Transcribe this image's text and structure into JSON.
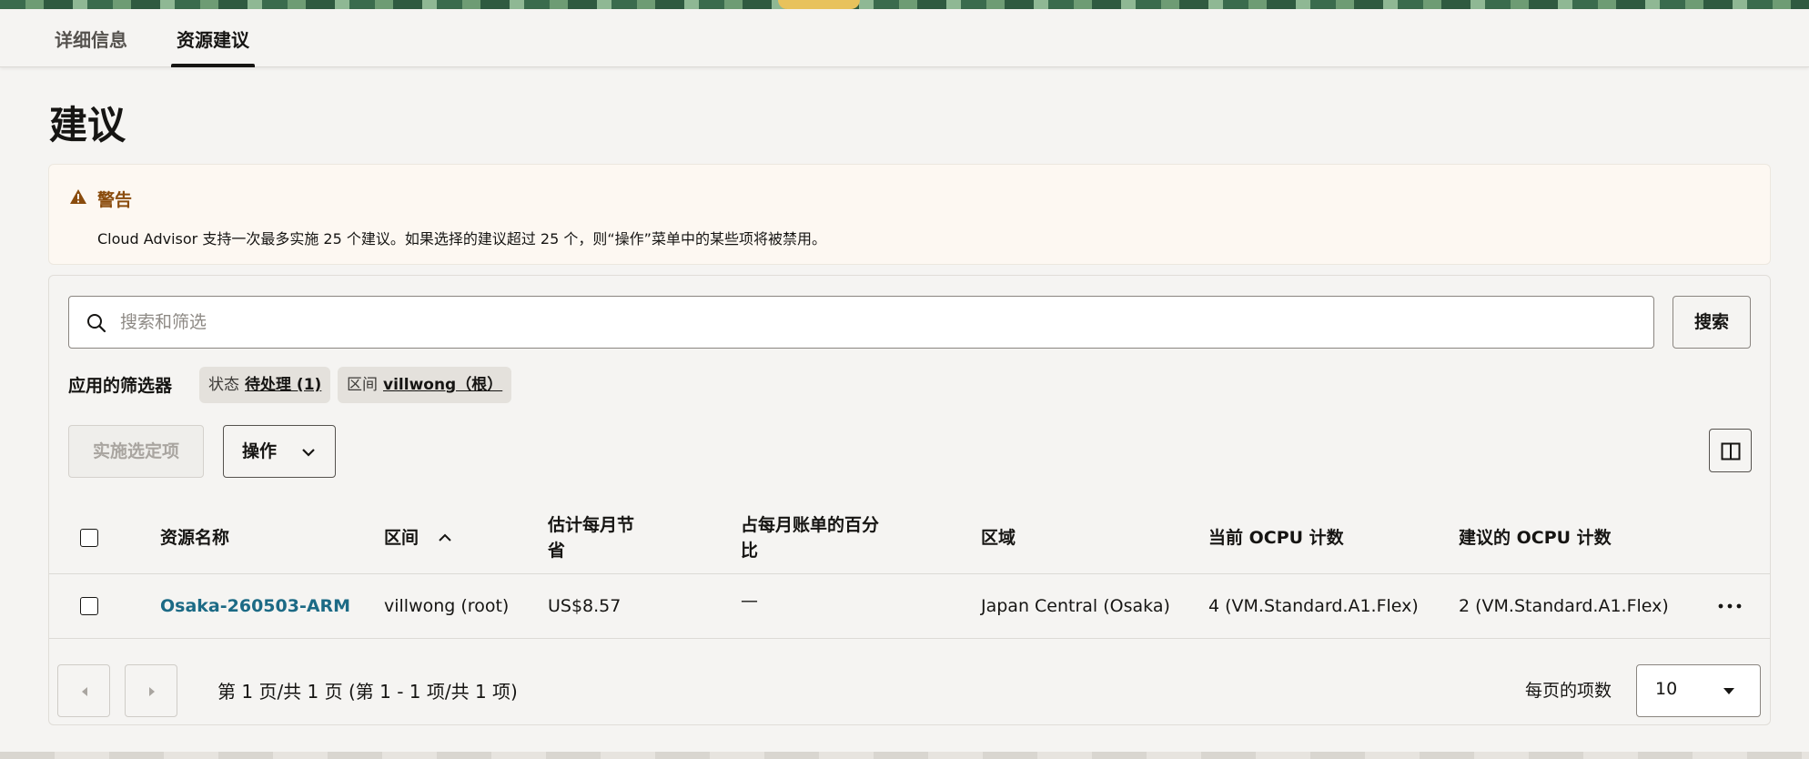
{
  "tabs": [
    {
      "label": "详细信息"
    },
    {
      "label": "资源建议"
    }
  ],
  "page": {
    "title": "建议"
  },
  "warning": {
    "title": "警告",
    "text": "Cloud Advisor 支持一次最多实施 25 个建议。如果选择的建议超过 25 个，则“操作”菜单中的某些项将被禁用。",
    "icon": "warning-triangle-icon",
    "color": "#8a4c0d"
  },
  "search": {
    "placeholder": "搜索和筛选",
    "button_label": "搜索"
  },
  "filters": {
    "label": "应用的筛选器",
    "chips": [
      {
        "key": "状态",
        "value": "待处理 (1)"
      },
      {
        "key": "区间",
        "value": "villwong（根）"
      }
    ]
  },
  "toolbar": {
    "implement_label": "实施选定项",
    "actions_label": "操作"
  },
  "table": {
    "headers": {
      "name": "资源名称",
      "compartment": "区间",
      "savings_line1": "估计每月节",
      "savings_line2": "省",
      "percent_line1": "占每月账单的百分",
      "percent_line2": "比",
      "region": "区域",
      "current_ocpu": "当前 OCPU 计数",
      "recommended_ocpu": "建议的 OCPU 计数"
    },
    "rows": [
      {
        "name": "Osaka-260503-ARM",
        "compartment": "villwong (root)",
        "savings": "US$8.57",
        "percent": "—",
        "region": "Japan Central (Osaka)",
        "current_ocpu": "4 (VM.Standard.A1.Flex)",
        "recommended_ocpu": "2 (VM.Standard.A1.Flex)"
      }
    ]
  },
  "pagination": {
    "info": "第 1 页/共 1 页 (第 1 - 1 项/共 1 项)",
    "per_page_label": "每页的项数",
    "per_page_value": "10"
  },
  "colors": {
    "accent_link": "#1c6a85",
    "warning_bg": "#fdf8f2"
  }
}
